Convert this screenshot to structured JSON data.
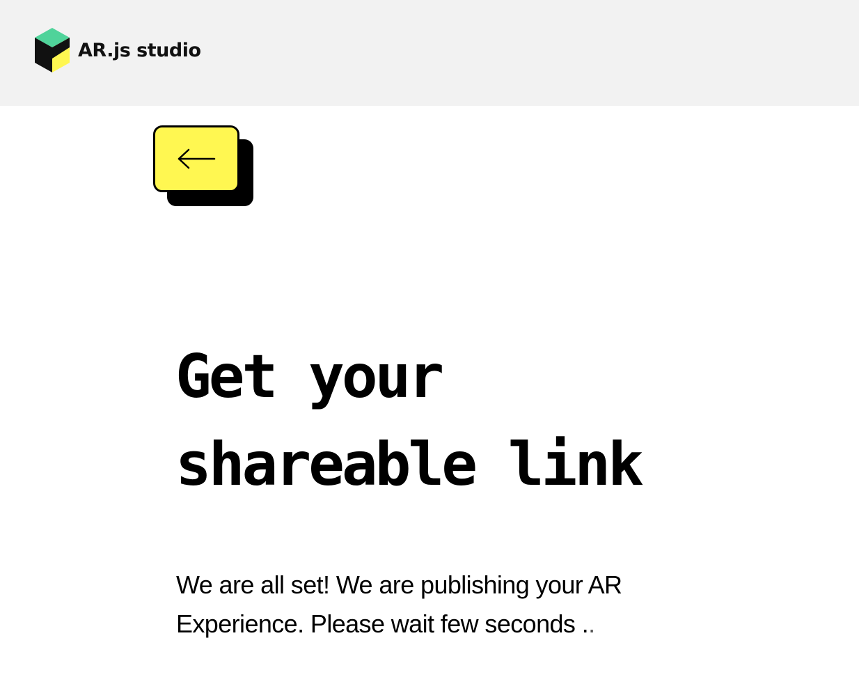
{
  "header": {
    "brand_name": "AR.js studio",
    "logo_icon": "arjs-cube-logo-icon",
    "background": "#f2f2f2"
  },
  "back_button": {
    "icon": "arrow-left-icon",
    "fill": "#fff751",
    "border": "#000000",
    "shadow": "#000000"
  },
  "main": {
    "title_line_1": "Get your",
    "title_line_2": "shareable link",
    "message": "We are all set! We are publishing your AR Experience. Please wait few seconds .",
    "loading_dots": "."
  }
}
